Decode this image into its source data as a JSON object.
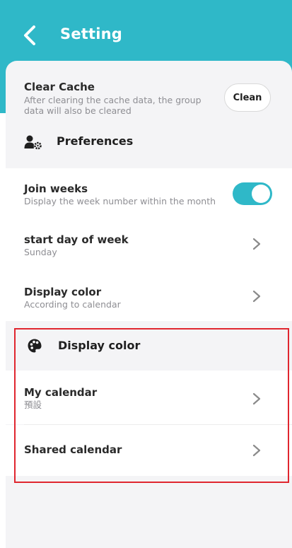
{
  "header": {
    "title": "Setting",
    "back_icon": "chevron-left-icon"
  },
  "clear_cache": {
    "title": "Clear Cache",
    "subtitle_line1": "After clearing the cache data, the group",
    "subtitle_line2": "data will also be cleared",
    "button_label": "Clean"
  },
  "preferences": {
    "section_title": "Preferences",
    "icon": "user-gear-icon",
    "join_weeks": {
      "title": "Join weeks",
      "subtitle": "Display the week number within the month",
      "enabled": true
    },
    "start_day": {
      "title": "start day of week",
      "subtitle": "Sunday"
    },
    "display_color": {
      "title": "Display color",
      "subtitle": "According to calendar"
    }
  },
  "display_color_section": {
    "section_title": "Display color",
    "icon": "palette-icon",
    "my_calendar": {
      "title": "My calendar",
      "subtitle": "預設"
    },
    "shared_calendar": {
      "title": "Shared calendar"
    }
  },
  "colors": {
    "accent": "#2fb8c8",
    "highlight_border": "#e0262f",
    "background": "#f4f4f6"
  }
}
